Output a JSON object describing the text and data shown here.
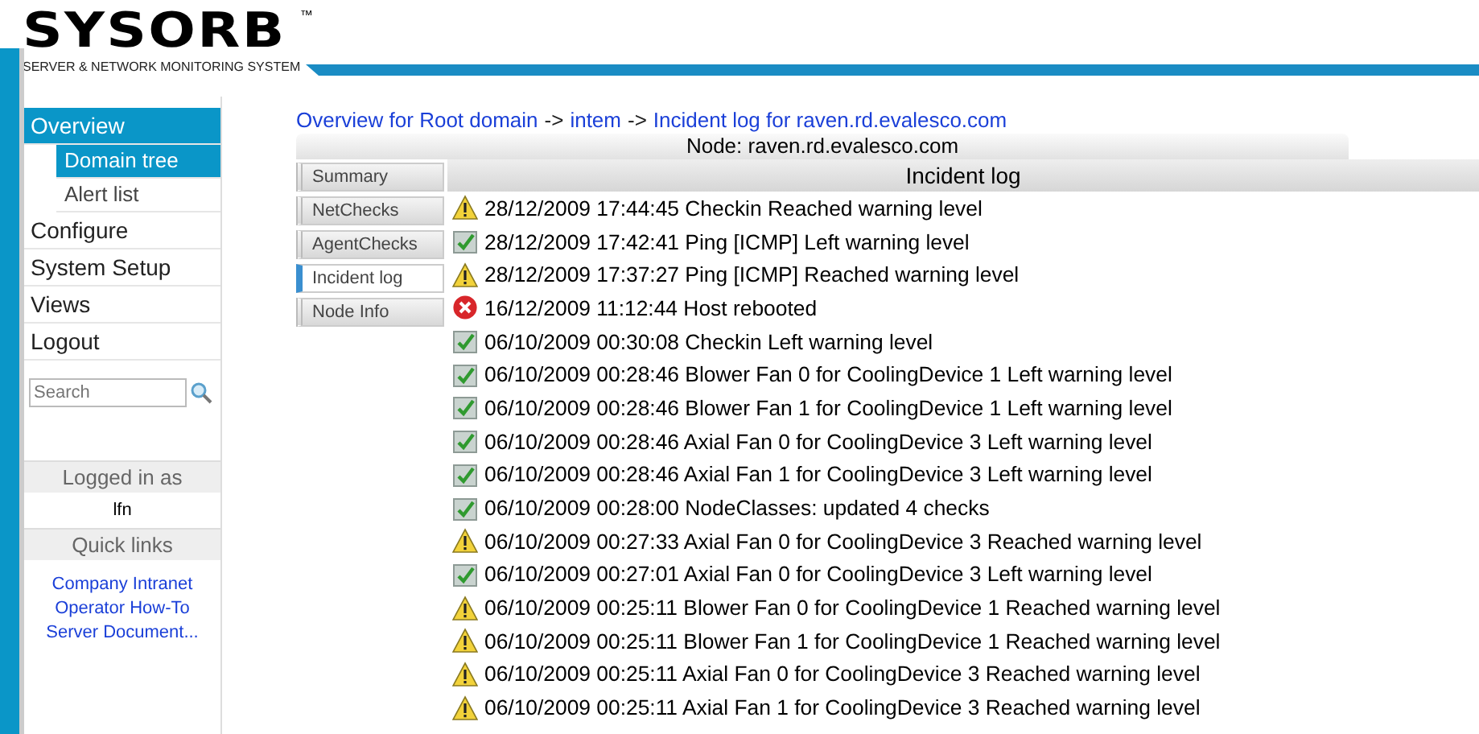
{
  "logo": {
    "name": "SYSORB",
    "trademark": "™",
    "tagline": "SERVER & NETWORK MONITORING SYSTEM"
  },
  "sidebar": {
    "items": [
      {
        "label": "Overview",
        "selected": true,
        "children": [
          {
            "label": "Domain tree",
            "selected": true
          },
          {
            "label": "Alert list",
            "selected": false
          }
        ]
      },
      {
        "label": "Configure",
        "selected": false
      },
      {
        "label": "System Setup",
        "selected": false
      },
      {
        "label": "Views",
        "selected": false
      },
      {
        "label": "Logout",
        "selected": false
      }
    ],
    "search": {
      "placeholder": "Search"
    },
    "logged_in": {
      "heading": "Logged in as",
      "user": "lfn"
    },
    "quick_links": {
      "heading": "Quick links",
      "links": [
        "Company Intranet",
        "Operator How-To",
        "Server Document..."
      ]
    }
  },
  "breadcrumb": {
    "separator": "->",
    "items": [
      "Overview for Root domain",
      "intem",
      "Incident log for raven.rd.evalesco.com"
    ]
  },
  "node_title": "Node: raven.rd.evalesco.com",
  "tabs": [
    {
      "label": "Summary",
      "selected": false
    },
    {
      "label": "NetChecks",
      "selected": false
    },
    {
      "label": "AgentChecks",
      "selected": false
    },
    {
      "label": "Incident log",
      "selected": true
    },
    {
      "label": "Node Info",
      "selected": false
    }
  ],
  "log": {
    "heading": "Incident log",
    "rows": [
      {
        "kind": "warning",
        "text": "28/12/2009 17:44:45 Checkin Reached warning level"
      },
      {
        "kind": "ok",
        "text": "28/12/2009 17:42:41 Ping [ICMP] Left warning level"
      },
      {
        "kind": "warning",
        "text": "28/12/2009 17:37:27 Ping [ICMP] Reached warning level"
      },
      {
        "kind": "error",
        "text": "16/12/2009 11:12:44 Host rebooted"
      },
      {
        "kind": "ok",
        "text": "06/10/2009 00:30:08 Checkin Left warning level"
      },
      {
        "kind": "ok",
        "text": "06/10/2009 00:28:46 Blower Fan 0 for CoolingDevice 1 Left warning level"
      },
      {
        "kind": "ok",
        "text": "06/10/2009 00:28:46 Blower Fan 1 for CoolingDevice 1 Left warning level"
      },
      {
        "kind": "ok",
        "text": "06/10/2009 00:28:46 Axial Fan 0 for CoolingDevice 3 Left warning level"
      },
      {
        "kind": "ok",
        "text": "06/10/2009 00:28:46 Axial Fan 1 for CoolingDevice 3 Left warning level"
      },
      {
        "kind": "ok",
        "text": "06/10/2009 00:28:00 NodeClasses: updated 4 checks"
      },
      {
        "kind": "warning",
        "text": "06/10/2009 00:27:33 Axial Fan 0 for CoolingDevice 3 Reached warning level"
      },
      {
        "kind": "ok",
        "text": "06/10/2009 00:27:01 Axial Fan 0 for CoolingDevice 3 Left warning level"
      },
      {
        "kind": "warning",
        "text": "06/10/2009 00:25:11 Blower Fan 0 for CoolingDevice 1 Reached warning level"
      },
      {
        "kind": "warning",
        "text": "06/10/2009 00:25:11 Blower Fan 1 for CoolingDevice 1 Reached warning level"
      },
      {
        "kind": "warning",
        "text": "06/10/2009 00:25:11 Axial Fan 0 for CoolingDevice 3 Reached warning level"
      },
      {
        "kind": "warning",
        "text": "06/10/2009 00:25:11 Axial Fan 1 for CoolingDevice 3 Reached warning level"
      }
    ]
  }
}
